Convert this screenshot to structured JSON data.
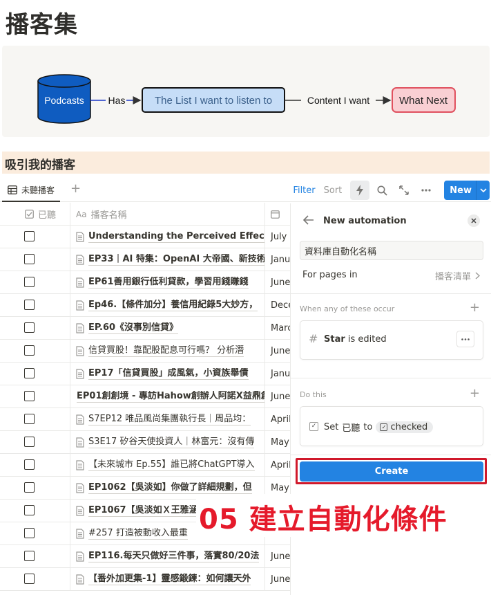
{
  "page": {
    "title": "播客集"
  },
  "diagram": {
    "nodes": {
      "podcasts": "Podcasts",
      "list": "The List I want to listen to",
      "what_next": "What Next"
    },
    "edges": {
      "has": "Has",
      "content": "Content I want"
    },
    "colors": {
      "podcasts_fill": "#0f5cc0",
      "list_fill": "#c6ddf7",
      "what_next_fill": "#f9cfd3",
      "what_next_border": "#e0505e"
    }
  },
  "section": {
    "heading": "吸引我的播客"
  },
  "view": {
    "tab_label": "未聽播客",
    "add_icon": "plus-icon",
    "filter": "Filter",
    "sort": "Sort",
    "new_label": "New"
  },
  "table": {
    "columns": {
      "checked": "已聽",
      "name": "播客名稱",
      "date_icon": "calendar-icon"
    },
    "rows": [
      {
        "name": "Understanding the Perceived Effectiveness",
        "date": "July",
        "bold": true
      },
      {
        "name": "EP33｜AI 特集：OpenAI 大帝國、新技術",
        "date": "Janua",
        "bold": true
      },
      {
        "name": "EP61善用銀行低利貸款，學習用錢賺錢",
        "date": "June",
        "bold": true
      },
      {
        "name": "Ep46.【條件加分】養信用紀錄5大妙方，",
        "date": "Dece",
        "bold": true
      },
      {
        "name": "EP.60《沒事別信貸》",
        "date": "Marc",
        "bold": true
      },
      {
        "name": "信貸買股！靠配股配息可行嗎？ 分析潛",
        "date": "June",
        "bold": false
      },
      {
        "name": "EP17「信貸買股」成風氣，小資族舉債",
        "date": "Janu",
        "bold": true
      },
      {
        "name": "EP01創創境 - 專訪Hahow創辦人阿諾X益鼎創",
        "date": "June",
        "bold": true,
        "no_icon": true
      },
      {
        "name": "S7EP12 唯品風尚集團執行長｜周品均：",
        "date": "April",
        "bold": false
      },
      {
        "name": "S3E17 矽谷天使投資人｜林富元：沒有傳",
        "date": "May",
        "bold": false
      },
      {
        "name": "【未來城市 Ep.55】誰已將ChatGPT導入",
        "date": "April",
        "bold": false
      },
      {
        "name": "EP1062【吳淡如】你做了詳細規劃，但",
        "date": "May",
        "bold": true
      },
      {
        "name": "EP1067【吳淡如Ｘ王雅涵",
        "date": "",
        "bold": true
      },
      {
        "name": "#257 打造被動收入最重",
        "date": "",
        "bold": false
      },
      {
        "name": "EP116.每天只做好三件事，落實80/20法",
        "date": "June",
        "bold": true
      },
      {
        "name": "【番外加更集-1】靈感鍛鍊：如何讓天外",
        "date": "June",
        "bold": true
      }
    ]
  },
  "automation": {
    "title": "New automation",
    "name_input_value": "資料庫自動化名稱",
    "for_pages_label": "For pages in",
    "database_name": "播客清單",
    "trigger_section": "When any of these occur",
    "trigger_prop": "Star",
    "trigger_suffix": "is edited",
    "action_section": "Do this",
    "action_prefix": "Set",
    "action_prop": "已聽",
    "action_to": "to",
    "action_value": "checked",
    "create_label": "Create"
  },
  "annotation": {
    "caption": "05 建立自動化條件",
    "color": "#e51a2b"
  }
}
